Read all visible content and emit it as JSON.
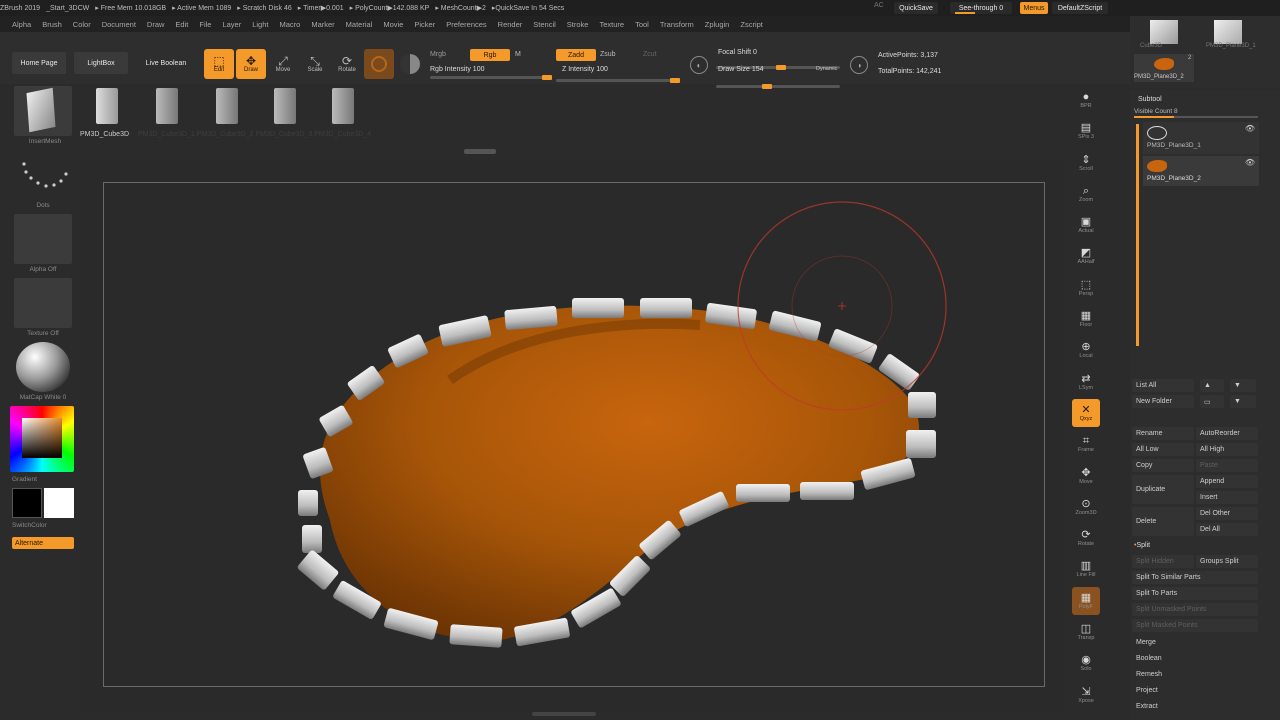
{
  "status_bar": [
    "ZBrush 2019",
    "_Start_3DCW",
    "▸ Free Mem 10.018GB",
    "▸ Active Mem 1089",
    "▸ Scratch Disk 46",
    "▸ Timer▶0.001",
    "▸ PolyCount▶142.088 KP",
    "▸ MeshCount▶2",
    "▸QuickSave In 54 Secs"
  ],
  "status_right": {
    "ac": "AC",
    "quicksave": "QuickSave",
    "see_through": "See-through  0",
    "menus": "Menus",
    "script": "DefaultZScript"
  },
  "menus": [
    "Alpha",
    "Brush",
    "Color",
    "Document",
    "Draw",
    "Edit",
    "File",
    "Layer",
    "Light",
    "Macro",
    "Marker",
    "Material",
    "Movie",
    "Picker",
    "Preferences",
    "Render",
    "Stencil",
    "Stroke",
    "Texture",
    "Tool",
    "Transform",
    "Zplugin",
    "Zscript"
  ],
  "toolbar": {
    "home_page": "Home Page",
    "lightbox": "LightBox",
    "live_boolean": "Live Boolean",
    "edit": "Edit",
    "draw": "Draw",
    "move": "Move",
    "scale": "Scale",
    "rotate": "Rotate",
    "mrgb": "Mrgb",
    "rgb": "Rgb",
    "m": "M",
    "zadd": "Zadd",
    "zsub": "Zsub",
    "zcut": "Zcut",
    "rgb_intensity": "Rgb Intensity 100",
    "z_intensity": "Z Intensity 100",
    "focal_shift": "Focal Shift 0",
    "draw_size": "Draw Size 154",
    "dynamic": "Dynamic",
    "active_points": "ActivePoints: 3,137",
    "total_points": "TotalPoints: 142,241"
  },
  "lightbox_strip": {
    "caption": "PM3D_Cube3D",
    "faded": "PM3D_Cube3D_1  PM3D_Cube3D_2  PM3D_Cube3D_3  PM3D_Cube3D_4"
  },
  "left_panel": {
    "brush_label": "InsertMesh",
    "dots_label": "Dots",
    "alpha_label": "Alpha Off",
    "texture_label": "Texture Off",
    "material_label": "MatCap White 0",
    "gradient_label": "Gradient",
    "switchcolor_label": "SwitchColor",
    "alternate_label": "Alternate"
  },
  "right_shelf": [
    {
      "icon": "bpr-icon",
      "label": "BPR"
    },
    {
      "icon": "spix-icon",
      "label": "SPix 3"
    },
    {
      "icon": "scroll-icon",
      "label": "Scroll"
    },
    {
      "icon": "zoom-icon",
      "label": "Zoom"
    },
    {
      "icon": "actual-icon",
      "label": "Actual"
    },
    {
      "icon": "aahalf-icon",
      "label": "AAHalf"
    },
    {
      "icon": "persp-icon",
      "label": "Persp"
    },
    {
      "icon": "floor-icon",
      "label": "Floor"
    },
    {
      "icon": "local-icon",
      "label": "Local"
    },
    {
      "icon": "lsym-icon",
      "label": "LSym"
    },
    {
      "icon": "xyz-icon",
      "label": "Qxyz"
    },
    {
      "icon": "frame-icon",
      "label": "Frame"
    },
    {
      "icon": "move-icon",
      "label": "Move"
    },
    {
      "icon": "zoom3d-icon",
      "label": "Zoom3D"
    },
    {
      "icon": "rotate-icon",
      "label": "Rotate"
    },
    {
      "icon": "linefill-icon",
      "label": "Line Fill"
    },
    {
      "icon": "polyf-icon",
      "label": "PolyF"
    },
    {
      "icon": "transp-icon",
      "label": "Transp"
    },
    {
      "icon": "solo-icon",
      "label": "Solo"
    },
    {
      "icon": "xpose-icon",
      "label": "Xpose"
    }
  ],
  "tool_thumbs": {
    "a": "Cube3D",
    "b": "PM3D_Plane3D_1",
    "current": "PM3D_Plane3D_2",
    "count": "2"
  },
  "subtool": {
    "title": "Subtool",
    "visible_count": "Visible Count 8",
    "items": [
      "PM3D_Plane3D_1",
      "PM3D_Plane3D_2"
    ],
    "list_all": "List All",
    "new_folder": "New Folder",
    "rename": "Rename",
    "autoreorder": "AutoReorder",
    "all_low": "All Low",
    "all_high": "All High",
    "copy": "Copy",
    "paste": "Paste",
    "duplicate": "Duplicate",
    "append": "Append",
    "insert": "Insert",
    "delete": "Delete",
    "del_other": "Del Other",
    "del_all": "Del All",
    "split_title": "Split",
    "split_hidden": "Split Hidden",
    "groups_split": "Groups Split",
    "split_similar": "Split To Similar Parts",
    "split_parts": "Split To Parts",
    "split_unmasked": "Split Unmasked Points",
    "split_masked": "Split Masked Points",
    "merge": "Merge",
    "boolean": "Boolean",
    "remesh": "Remesh",
    "project": "Project",
    "extract": "Extract"
  },
  "colors": {
    "accent": "#f39a2a",
    "clay": "#b05a0a",
    "bg": "#2b2b2b"
  }
}
